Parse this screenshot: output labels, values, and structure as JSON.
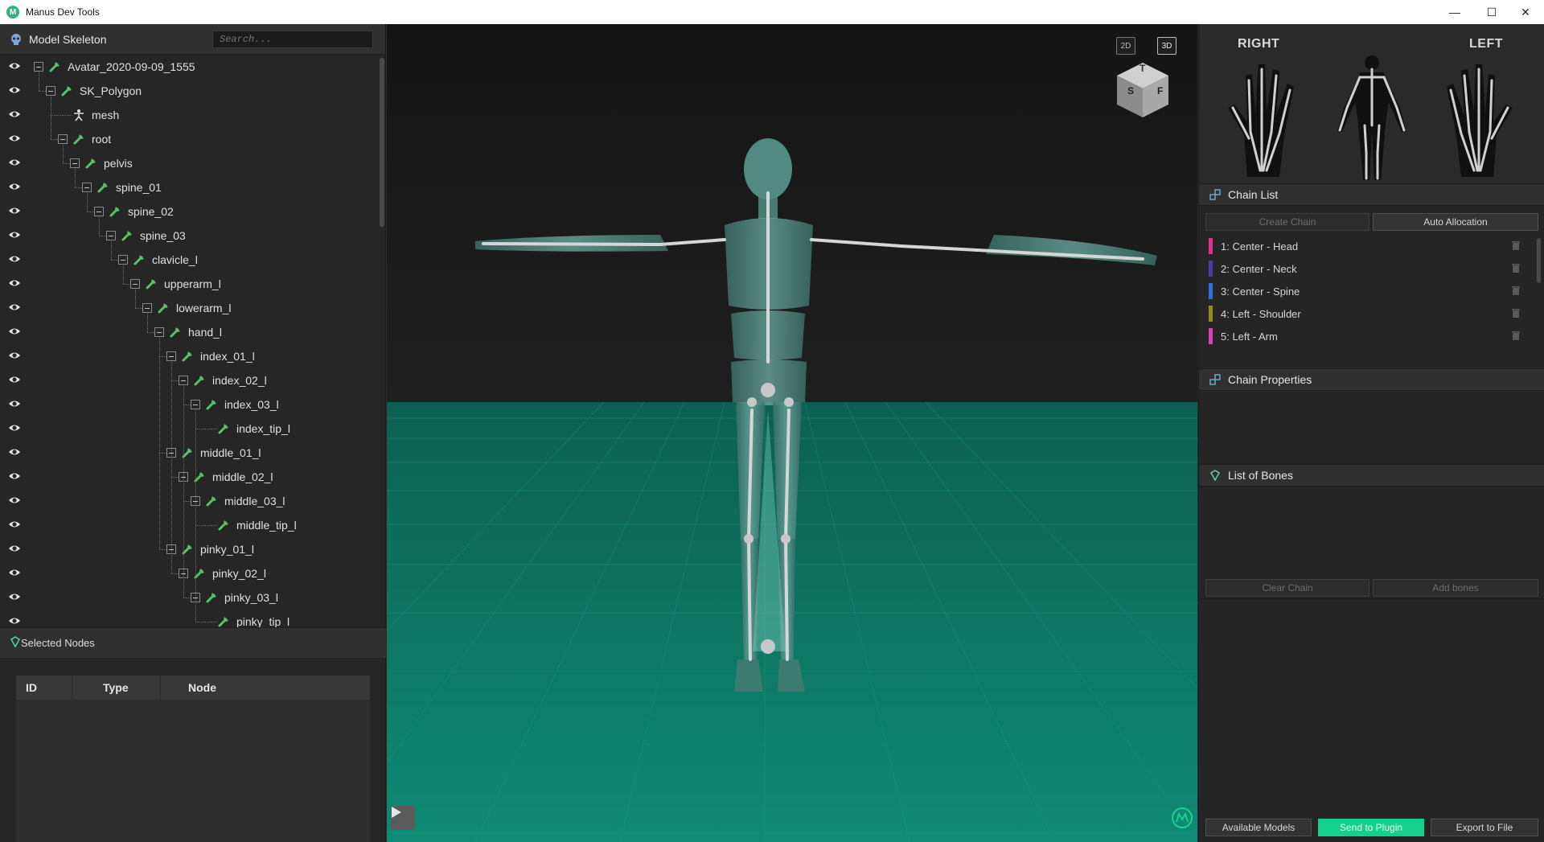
{
  "window": {
    "title": "Manus Dev Tools",
    "controls": [
      "minimize-icon",
      "maximize-icon",
      "close-icon"
    ]
  },
  "left_panel": {
    "header": {
      "title": "Model Skeleton",
      "icon": "skull-icon"
    },
    "search": {
      "placeholder": "Search..."
    },
    "tree": [
      {
        "label": "Avatar_2020-09-09_1555",
        "depth": 0,
        "toggle": true,
        "icon": "bone-icon"
      },
      {
        "label": "SK_Polygon",
        "depth": 1,
        "toggle": true,
        "icon": "bone-icon"
      },
      {
        "label": "mesh",
        "depth": 2,
        "toggle": false,
        "icon": "person-icon"
      },
      {
        "label": "root",
        "depth": 2,
        "toggle": true,
        "icon": "bone-icon"
      },
      {
        "label": "pelvis",
        "depth": 3,
        "toggle": true,
        "icon": "bone-icon"
      },
      {
        "label": "spine_01",
        "depth": 4,
        "toggle": true,
        "icon": "bone-icon"
      },
      {
        "label": "spine_02",
        "depth": 5,
        "toggle": true,
        "icon": "bone-icon"
      },
      {
        "label": "spine_03",
        "depth": 6,
        "toggle": true,
        "icon": "bone-icon"
      },
      {
        "label": "clavicle_l",
        "depth": 7,
        "toggle": true,
        "icon": "bone-icon"
      },
      {
        "label": "upperarm_l",
        "depth": 8,
        "toggle": true,
        "icon": "bone-icon"
      },
      {
        "label": "lowerarm_l",
        "depth": 9,
        "toggle": true,
        "icon": "bone-icon"
      },
      {
        "label": "hand_l",
        "depth": 10,
        "toggle": true,
        "icon": "bone-icon"
      },
      {
        "label": "index_01_l",
        "depth": 11,
        "toggle": true,
        "icon": "bone-icon"
      },
      {
        "label": "index_02_l",
        "depth": 12,
        "toggle": true,
        "icon": "bone-icon"
      },
      {
        "label": "index_03_l",
        "depth": 13,
        "toggle": true,
        "icon": "bone-icon"
      },
      {
        "label": "index_tip_l",
        "depth": 14,
        "toggle": false,
        "icon": "bone-icon"
      },
      {
        "label": "middle_01_l",
        "depth": 11,
        "toggle": true,
        "icon": "bone-icon"
      },
      {
        "label": "middle_02_l",
        "depth": 12,
        "toggle": true,
        "icon": "bone-icon"
      },
      {
        "label": "middle_03_l",
        "depth": 13,
        "toggle": true,
        "icon": "bone-icon"
      },
      {
        "label": "middle_tip_l",
        "depth": 14,
        "toggle": false,
        "icon": "bone-icon"
      },
      {
        "label": "pinky_01_l",
        "depth": 11,
        "toggle": true,
        "icon": "bone-icon"
      },
      {
        "label": "pinky_02_l",
        "depth": 12,
        "toggle": true,
        "icon": "bone-icon"
      },
      {
        "label": "pinky_03_l",
        "depth": 13,
        "toggle": true,
        "icon": "bone-icon"
      },
      {
        "label": "pinky_tip_l",
        "depth": 14,
        "toggle": false,
        "icon": "bone-icon"
      }
    ],
    "selected_nodes": {
      "title": "Selected Nodes",
      "icon": "gem-icon",
      "columns": [
        "ID",
        "Type",
        "Node"
      ]
    }
  },
  "viewport": {
    "view_buttons": {
      "two_d": "2D",
      "three_d": "3D"
    },
    "gizmo": {
      "top": "T",
      "side": "S",
      "front": "F"
    },
    "play_icon": "play-icon",
    "logo_icon": "manus-logo-icon"
  },
  "right_panel": {
    "body_map": {
      "right_label": "RIGHT",
      "left_label": "LEFT"
    },
    "chain_list": {
      "title": "Chain List",
      "icon": "chain-icon",
      "create_button": "Create Chain",
      "auto_button": "Auto Allocation",
      "items": [
        {
          "label": "1: Center - Head",
          "color": "#e0308c"
        },
        {
          "label": "2: Center - Neck",
          "color": "#4a3aa8"
        },
        {
          "label": "3: Center - Spine",
          "color": "#2f6fe0"
        },
        {
          "label": "4: Left - Shoulder",
          "color": "#9a8a18"
        },
        {
          "label": "5: Left - Arm",
          "color": "#e040c0"
        }
      ]
    },
    "chain_properties": {
      "title": "Chain Properties",
      "icon": "chain-icon"
    },
    "list_of_bones": {
      "title": "List of Bones",
      "icon": "gem-icon",
      "clear_button": "Clear Chain",
      "add_button": "Add bones"
    },
    "footer": {
      "available_models": "Available Models",
      "send_to_plugin": "Send to Plugin",
      "export_to_file": "Export to File"
    }
  },
  "colors": {
    "accent": "#13d08c",
    "bone_green": "#55c46a",
    "floor": "#0e7a68"
  }
}
